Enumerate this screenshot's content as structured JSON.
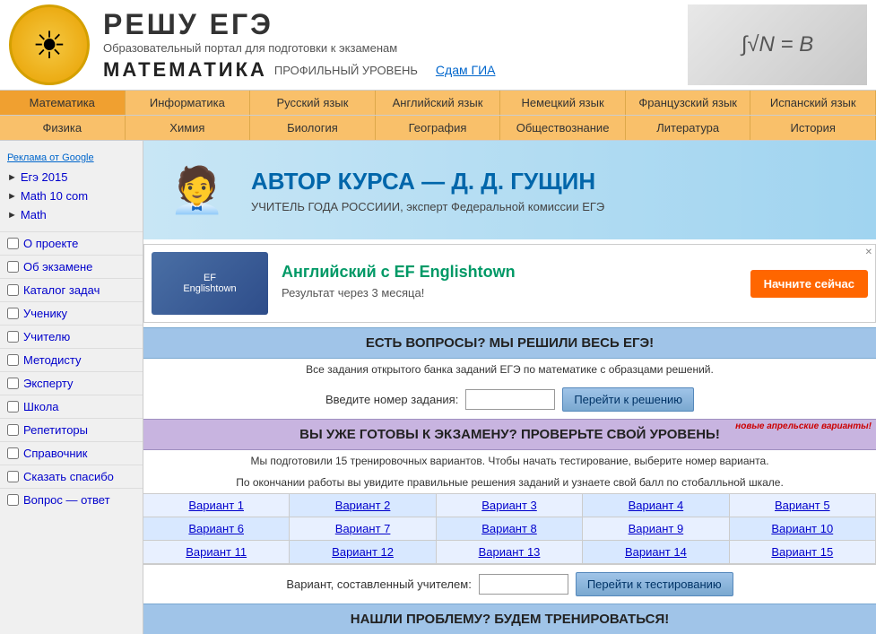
{
  "header": {
    "title": "РЕШУ ЕГЭ",
    "subtitle": "Образовательный портал для подготовки к экзаменам",
    "math_label": "МАТЕМАТИКА",
    "level_label": "ПРОФИЛЬНЫЙ УРОВЕНЬ",
    "gia_link": "Сдам ГИА"
  },
  "nav_row1": [
    {
      "label": "Математика",
      "active": true
    },
    {
      "label": "Информатика"
    },
    {
      "label": "Русский язык"
    },
    {
      "label": "Английский язык"
    },
    {
      "label": "Немецкий язык"
    },
    {
      "label": "Французский язык"
    },
    {
      "label": "Испанский язык"
    }
  ],
  "nav_row2": [
    {
      "label": "Физика"
    },
    {
      "label": "Химия"
    },
    {
      "label": "Биология"
    },
    {
      "label": "География"
    },
    {
      "label": "Обществознание"
    },
    {
      "label": "Литература"
    },
    {
      "label": "История"
    }
  ],
  "sidebar": {
    "ad_label": "Реклама от Google",
    "links": [
      {
        "label": "Егэ 2015"
      },
      {
        "label": "Math 10 com"
      },
      {
        "label": "Math"
      }
    ],
    "nav_items": [
      {
        "label": "О проекте"
      },
      {
        "label": "Об экзамене"
      },
      {
        "label": "Каталог задач"
      },
      {
        "label": "Ученику"
      },
      {
        "label": "Учителю"
      },
      {
        "label": "Методисту"
      },
      {
        "label": "Эксперту"
      },
      {
        "label": "Школа"
      },
      {
        "label": "Репетиторы"
      },
      {
        "label": "Справочник"
      },
      {
        "label": "Сказать спасибо"
      },
      {
        "label": "Вопрос — ответ"
      }
    ]
  },
  "author_banner": {
    "title": "АВТОР КУРСА — Д. Д. ГУЩИН",
    "subtitle": "УЧИТЕЛЬ ГОДА РОССИИИ, эксперт Федеральной комиссии ЕГЭ"
  },
  "ad_banner": {
    "title": "Английский с EF Englishtown",
    "subtitle": "Результат через 3 месяца!",
    "button_label": "Начните сейчас"
  },
  "questions_section": {
    "header": "ЕСТЬ ВОПРОСЫ? МЫ РЕШИЛИ ВЕСЬ ЕГЭ!",
    "subtext": "Все задания открытого банка заданий ЕГЭ по математике с образцами решений.",
    "input_label": "Введите номер задания:",
    "button_label": "Перейти к решению",
    "placeholder": ""
  },
  "variants_section": {
    "header": "ВЫ УЖЕ ГОТОВЫ К ЭКЗАМЕНУ? ПРОВЕРЬТЕ СВОЙ УРОВЕНЬ!",
    "new_badge": "новые апрельские варианты!",
    "subtext1": "Мы подготовили 15 тренировочных вариантов. Чтобы начать тестирование, выберите номер варианта.",
    "subtext2": "По окончании работы вы увидите правильные решения заданий и узнаете свой балл по стобалльной шкале.",
    "variants": [
      "Вариант 1",
      "Вариант 2",
      "Вариант 3",
      "Вариант 4",
      "Вариант 5",
      "Вариант 6",
      "Вариант 7",
      "Вариант 8",
      "Вариант 9",
      "Вариант 10",
      "Вариант 11",
      "Вариант 12",
      "Вариант 13",
      "Вариант 14",
      "Вариант 15"
    ],
    "teacher_label": "Вариант, составленный учителем:",
    "teacher_button": "Перейти к тестированию",
    "placeholder": ""
  },
  "bottom_section": {
    "header": "НАШЛИ ПРОБЛЕМУ? БУДЕМ ТРЕНИРОВАТЬСЯ!"
  }
}
